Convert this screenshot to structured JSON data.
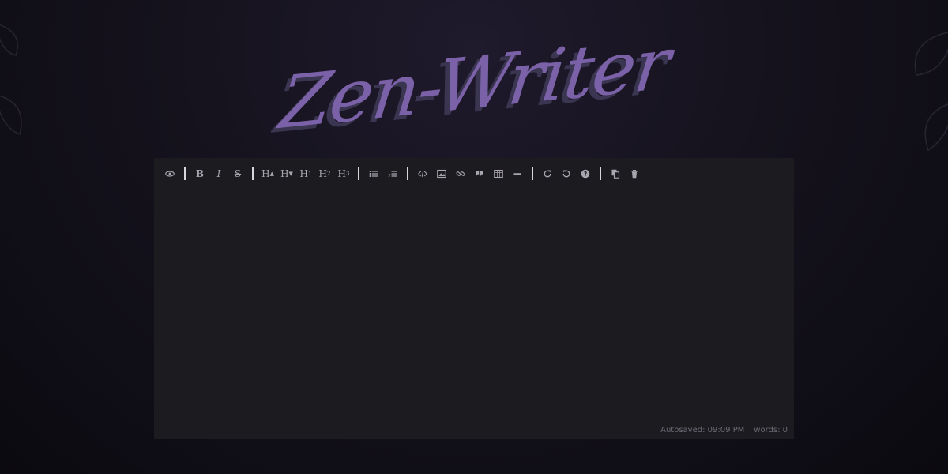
{
  "app": {
    "title": "Zen-Writer"
  },
  "toolbar": {
    "buttons": [
      {
        "name": "preview-eye-icon",
        "label": ""
      },
      {
        "name": "bold-button",
        "label": "B"
      },
      {
        "name": "italic-button",
        "label": "I"
      },
      {
        "name": "strikethrough-button",
        "label": "S"
      },
      {
        "name": "heading-bigger-button",
        "label": "H"
      },
      {
        "name": "heading-smaller-button",
        "label": "H"
      },
      {
        "name": "heading-1-button",
        "label": "H"
      },
      {
        "name": "heading-2-button",
        "label": "H"
      },
      {
        "name": "heading-3-button",
        "label": "H"
      }
    ]
  },
  "status": {
    "autosaved": "Autosaved: 09:09 PM",
    "words": "words: 0"
  },
  "colors": {
    "accent": "#7b62a8",
    "editor_bg": "#1c1b20",
    "icon": "#a9a6b0"
  }
}
